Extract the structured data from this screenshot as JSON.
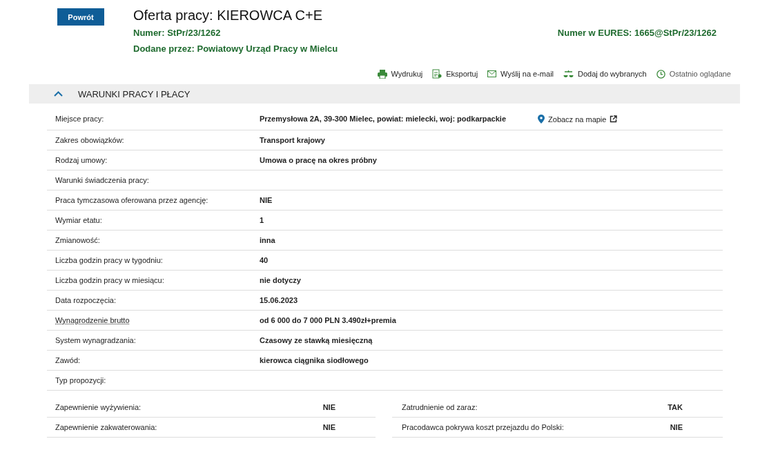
{
  "back_button": "Powrót",
  "title": "Oferta pracy: KIEROWCA C+E",
  "number": {
    "label": "Numer:",
    "value": "StPr/23/1262"
  },
  "eures": {
    "label": "Numer w EURES:",
    "value": "1665@StPr/23/1262"
  },
  "added_by": {
    "label": "Dodane przez:",
    "value": "Powiatowy Urząd Pracy w Mielcu"
  },
  "actions": [
    {
      "kind": "print",
      "label": "Wydrukuj"
    },
    {
      "kind": "export",
      "label": "Eksportuj"
    },
    {
      "kind": "email",
      "label": "Wyślij na e-mail"
    },
    {
      "kind": "favorite",
      "label": "Dodaj do wybranych"
    },
    {
      "kind": "recent",
      "label": "Ostatnio oglądane"
    }
  ],
  "section": {
    "title": "WARUNKI PRACY I PŁACY",
    "expanded": true,
    "rows": [
      {
        "label": "Miejsce pracy:",
        "value": "Przemysłowa 2A, 39-300 Mielec, powiat: mielecki, woj: podkarpackie",
        "map_link": "Zobacz na mapie"
      },
      {
        "label": "Zakres obowiązków:",
        "value": "Transport krajowy"
      },
      {
        "label": "Rodzaj umowy:",
        "value": "Umowa o pracę na okres próbny"
      },
      {
        "label": "Warunki świadczenia pracy:"
      },
      {
        "label": "Praca tymczasowa oferowana przez agencję:",
        "value": "NIE"
      },
      {
        "label": "Wymiar etatu:",
        "value": "1"
      },
      {
        "label": "Zmianowość:",
        "value": "inna"
      },
      {
        "label": "Liczba godzin pracy w tygodniu:",
        "value": "40"
      },
      {
        "label": "Liczba godzin pracy w miesiącu:",
        "value": "nie dotyczy"
      },
      {
        "label": "Data rozpoczęcia:",
        "value": "15.06.2023"
      },
      {
        "label": "Wynagrodzenie brutto",
        "value": "od 6 000 do 7 000 PLN 3.490zł+premia",
        "explained_term": true
      },
      {
        "label": "System wynagradzania:",
        "value": "Czasowy ze stawką miesięczną"
      },
      {
        "label": "Zawód:",
        "value": "kierowca ciągnika siodłowego"
      },
      {
        "label": "Typ propozycji:"
      }
    ],
    "pairs": [
      {
        "left": {
          "label": "Zapewnienie wyżywienia:",
          "value": "NIE"
        },
        "right": {
          "label": "Zatrudnienie od zaraz:",
          "value": "TAK"
        }
      },
      {
        "left": {
          "label": "Zapewnienie zakwaterowania:",
          "value": "NIE"
        },
        "right": {
          "label": "Pracodawca pokrywa koszt przejazdu do Polski:",
          "value": "NIE"
        }
      }
    ]
  }
}
